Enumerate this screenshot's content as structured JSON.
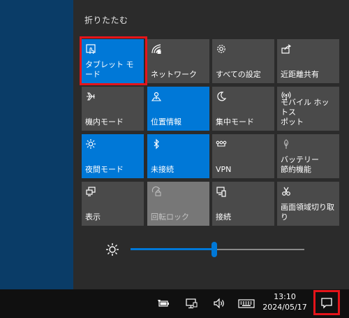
{
  "panel": {
    "collapse_label": "折りたたむ",
    "tiles": [
      {
        "label": "タブレット モード",
        "icon": "tablet-mode-icon",
        "state": "on"
      },
      {
        "label": "ネットワーク",
        "icon": "network-icon",
        "state": "off"
      },
      {
        "label": "すべての設定",
        "icon": "gear-icon",
        "state": "off"
      },
      {
        "label": "近距離共有",
        "icon": "share-icon",
        "state": "off"
      },
      {
        "label": "機内モード",
        "icon": "airplane-icon",
        "state": "off"
      },
      {
        "label": "位置情報",
        "icon": "location-icon",
        "state": "on"
      },
      {
        "label": "集中モード",
        "icon": "moon-icon",
        "state": "off"
      },
      {
        "label": "モバイル ホットス\nポット",
        "icon": "hotspot-icon",
        "state": "off"
      },
      {
        "label": "夜間モード",
        "icon": "night-light-icon",
        "state": "on"
      },
      {
        "label": "未接続",
        "icon": "bluetooth-icon",
        "state": "on"
      },
      {
        "label": "VPN",
        "icon": "vpn-icon",
        "state": "off"
      },
      {
        "label": "バッテリー\n節約機能",
        "icon": "battery-saver-icon",
        "state": "off"
      },
      {
        "label": "表示",
        "icon": "display-icon",
        "state": "off"
      },
      {
        "label": "回転ロック",
        "icon": "rotation-lock-icon",
        "state": "disabled"
      },
      {
        "label": "接続",
        "icon": "connect-icon",
        "state": "off"
      },
      {
        "label": "画面領域切り取\nり",
        "icon": "snip-icon",
        "state": "off"
      }
    ],
    "brightness_level": 0.48
  },
  "taskbar": {
    "time": "13:10",
    "date": "2024/05/17"
  },
  "colors": {
    "accent": "#0078d7",
    "tile_off": "#4a4a4a",
    "panel_bg": "#2b2b2b",
    "highlight": "#e5141a"
  }
}
